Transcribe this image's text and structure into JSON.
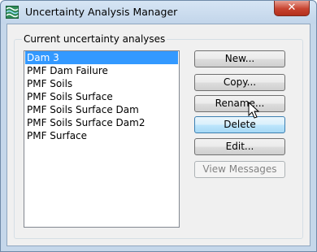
{
  "window": {
    "title": "Uncertainty Analysis Manager",
    "close_glyph": "✕"
  },
  "group": {
    "label": "Current uncertainty analyses"
  },
  "analyses": [
    "Dam 3",
    "PMF Dam Failure",
    "PMF Soils",
    "PMF Soils Surface",
    "PMF Soils Surface Dam",
    "PMF Soils Surface Dam2",
    "PMF Surface"
  ],
  "selected_analysis": "Dam 3",
  "buttons": {
    "new": "New...",
    "copy": "Copy...",
    "rename": "Rename...",
    "delete": "Delete",
    "edit": "Edit...",
    "view_messages": "View Messages"
  },
  "colors": {
    "selection": "#3399ff",
    "hover_border": "#3c7fb1"
  },
  "icons": {
    "app": "uncertainty-app-icon",
    "close": "close-icon",
    "cursor": "arrow-cursor-icon"
  }
}
